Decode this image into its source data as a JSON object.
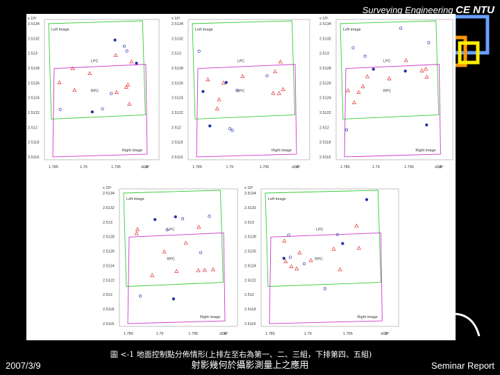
{
  "header": {
    "prefix": "Surveying Engineering",
    "brand": "CE NTU"
  },
  "panels": [
    {
      "left_label": "Left image",
      "right_label": "Right image",
      "lpc": "LPC",
      "rpc": "RPC",
      "exp": "x 10⁶",
      "yticks": [
        "2.5134",
        "2.5132",
        "2.513",
        "2.5128",
        "2.5126",
        "2.5124",
        "2.5122",
        "2.512",
        "2.5118",
        "2.5116"
      ],
      "xticks": [
        "1.785",
        "1.79",
        "1.795",
        "1.8"
      ],
      "xexp": "x 10⁵"
    },
    {
      "left_label": "Left image",
      "right_label": "Right image",
      "lpc": "LPC",
      "rpc": "RPC",
      "exp": "x 10⁶",
      "yticks": [
        "2.5134",
        "2.5132",
        "2.513",
        "2.5128",
        "2.5126",
        "2.5124",
        "2.5122",
        "2.512",
        "2.5118",
        "2.5116"
      ],
      "xticks": [
        "1.785",
        "1.79",
        "1.795",
        "1.8"
      ],
      "xexp": "x 10⁵"
    },
    {
      "left_label": "Left image",
      "right_label": "Right image",
      "lpc": "LPC",
      "rpc": "RPC",
      "exp": "x 10⁶",
      "yticks": [
        "2.5134",
        "2.5132",
        "2.513",
        "2.5128",
        "2.5126",
        "2.5124",
        "2.5122",
        "2.512",
        "2.5118",
        "2.5116"
      ],
      "xticks": [
        "1.785",
        "1.79",
        "1.795",
        "1.8"
      ],
      "xexp": "x 10⁵"
    },
    {
      "left_label": "Left image",
      "right_label": "Right image",
      "lpc": "LPC",
      "rpc": "RPC",
      "exp": "x 10⁶",
      "yticks": [
        "2.5134",
        "2.5132",
        "2.513",
        "2.5128",
        "2.5126",
        "2.5124",
        "2.5122",
        "2.512",
        "2.5118",
        "2.5116"
      ],
      "xticks": [
        "1.785",
        "1.79",
        "1.795",
        "1.8"
      ],
      "xexp": "x 10⁵"
    },
    {
      "left_label": "Left image",
      "right_label": "Right image",
      "lpc": "LPC",
      "rpc": "RPC",
      "exp": "x 10⁶",
      "yticks": [
        "2.5134",
        "2.5132",
        "2.513",
        "2.5128",
        "2.5126",
        "2.5124",
        "2.5122",
        "2.512",
        "2.5118",
        "2.5116"
      ],
      "xticks": [
        "1.785",
        "1.79",
        "1.795",
        "1.8"
      ],
      "xexp": "x 10⁵"
    }
  ],
  "caption": "圖 <-1 地面控制點分佈情形(上排左至右為第一、二、三組，下排第四、五組)",
  "footer": {
    "date": "2007/3/9",
    "title": "射影幾何於攝影測量上之應用",
    "report": "Seminar Report"
  },
  "colors": {
    "green": "#33cc33",
    "magenta": "#cc33cc",
    "red": "#e03030",
    "blue": "#2233aa",
    "deco_blue": "#6aa0ff",
    "deco_orange": "#ff9900",
    "deco_yellow": "#ffee00"
  }
}
